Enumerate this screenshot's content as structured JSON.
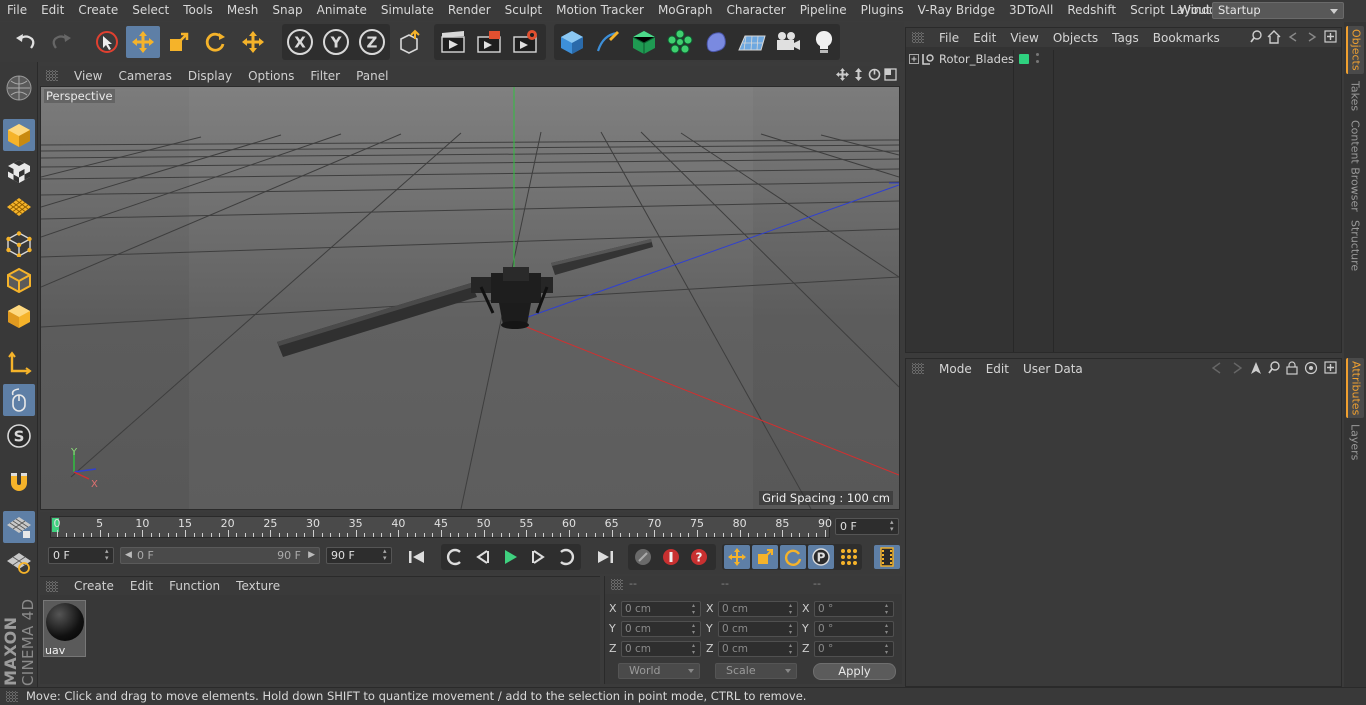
{
  "menubar": {
    "items": [
      "File",
      "Edit",
      "Create",
      "Select",
      "Tools",
      "Mesh",
      "Snap",
      "Animate",
      "Simulate",
      "Render",
      "Sculpt",
      "Motion Tracker",
      "MoGraph",
      "Character",
      "Pipeline",
      "Plugins",
      "V-Ray Bridge",
      "3DToAll",
      "Redshift",
      "Script",
      "Window",
      "Help"
    ],
    "layout_label": "Layout:",
    "layout_value": "Startup"
  },
  "viewport": {
    "menu": [
      "View",
      "Cameras",
      "Display",
      "Options",
      "Filter",
      "Panel"
    ],
    "label": "Perspective",
    "grid_spacing": "Grid Spacing : 100 cm",
    "axis_y": "Y",
    "axis_x": "X"
  },
  "timeline": {
    "ticks": [
      "0",
      "5",
      "10",
      "15",
      "20",
      "25",
      "30",
      "35",
      "40",
      "45",
      "50",
      "55",
      "60",
      "65",
      "70",
      "75",
      "80",
      "85",
      "90"
    ],
    "current_frame": "0 F",
    "start_frame": "0 F",
    "range_start": "0 F",
    "range_end": "90 F",
    "end_frame": "90 F"
  },
  "material_panel": {
    "menu": [
      "Create",
      "Edit",
      "Function",
      "Texture"
    ],
    "material_name": "uav"
  },
  "coordinates": {
    "headers": [
      "--",
      "--",
      "--"
    ],
    "rows": [
      {
        "axis": "X",
        "pos": "0 cm",
        "size_axis": "X",
        "size": "0 cm",
        "rot_axis": "X",
        "rot": "0 °"
      },
      {
        "axis": "Y",
        "pos": "0 cm",
        "size_axis": "Y",
        "size": "0 cm",
        "rot_axis": "Y",
        "rot": "0 °"
      },
      {
        "axis": "Z",
        "pos": "0 cm",
        "size_axis": "Z",
        "size": "0 cm",
        "rot_axis": "Z",
        "rot": "0 °"
      }
    ],
    "mode_world": "World",
    "mode_scale": "Scale",
    "apply": "Apply"
  },
  "object_manager": {
    "menu": [
      "File",
      "Edit",
      "View",
      "Objects",
      "Tags",
      "Bookmarks"
    ],
    "objects": [
      {
        "name": "Rotor_Blades",
        "tag_color": "#2fd17f"
      }
    ]
  },
  "attribute_manager": {
    "menu": [
      "Mode",
      "Edit",
      "User Data"
    ]
  },
  "right_tabs": [
    "Objects",
    "Takes",
    "Content Browser",
    "Structure",
    "Attributes",
    "Layers"
  ],
  "status": "Move: Click and drag to move elements. Hold down SHIFT to quantize movement / add to the selection in point mode, CTRL to remove.",
  "brand": {
    "line1": "MAXON",
    "line2": "CINEMA 4D"
  },
  "colors": {
    "accent": "#5e7fa6",
    "highlight": "#f0a030",
    "playhead": "#3fd17f",
    "axis_x": "#d03030",
    "axis_y": "#30c040",
    "axis_z": "#3040d0"
  }
}
